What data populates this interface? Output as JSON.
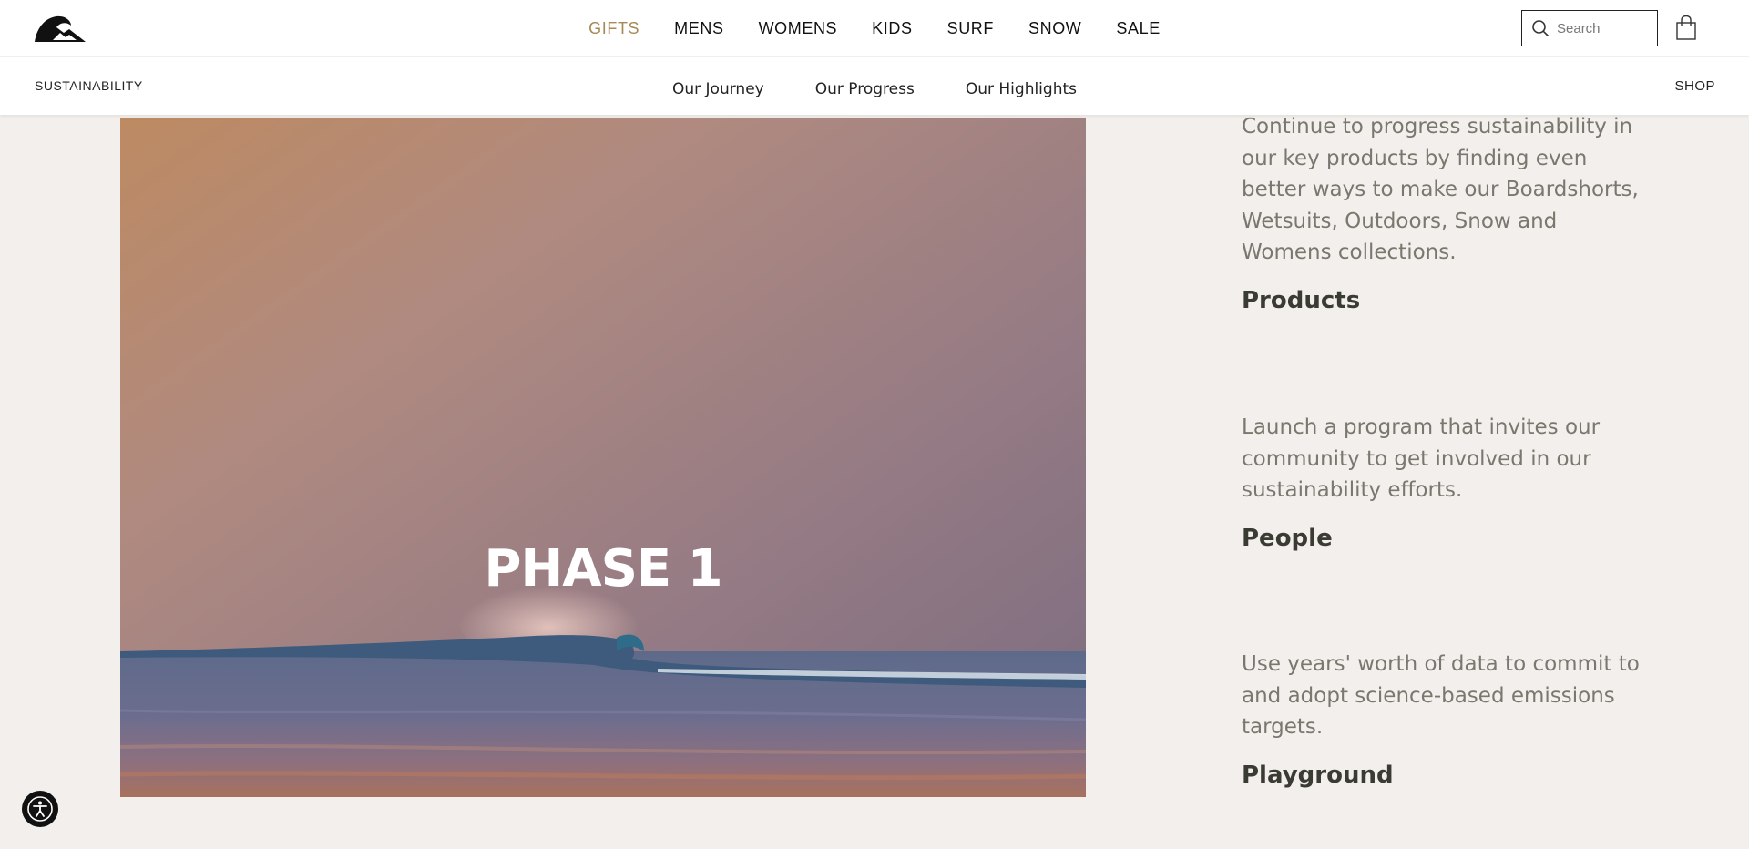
{
  "header": {
    "nav": [
      {
        "label": "GIFTS",
        "accent": "#a58a55"
      },
      {
        "label": "MENS"
      },
      {
        "label": "WOMENS"
      },
      {
        "label": "KIDS"
      },
      {
        "label": "SURF"
      },
      {
        "label": "SNOW"
      },
      {
        "label": "SALE"
      }
    ],
    "search_placeholder": "Search",
    "icons": {
      "logo": "quiksilver-wave-logo",
      "search": "search-icon",
      "cart": "shopping-bag-icon"
    }
  },
  "subnav": {
    "left_label": "SUSTAINABILITY",
    "links": [
      {
        "label": "Our Journey"
      },
      {
        "label": "Our Progress"
      },
      {
        "label": "Our Highlights"
      }
    ],
    "right_label": "SHOP"
  },
  "hero": {
    "title": "PHASE 1"
  },
  "pillars": [
    {
      "text": "Continue to progress sustainability in our key products by finding even better ways to make our Boardshorts, Wetsuits, Outdoors, Snow and Womens collections.",
      "heading": "Products"
    },
    {
      "text": "Launch a program that invites our community to get involved in our sustainability efforts.",
      "heading": "People"
    },
    {
      "text": "Use years' worth of data to commit to and adopt science-based emissions targets.",
      "heading": "Playground"
    }
  ],
  "colors": {
    "background": "#f3efec",
    "heading": "#3a3c33",
    "body_text": "#7a776e",
    "accent_gold": "#a58a55"
  },
  "accessibility": {
    "icon": "accessibility-icon"
  }
}
